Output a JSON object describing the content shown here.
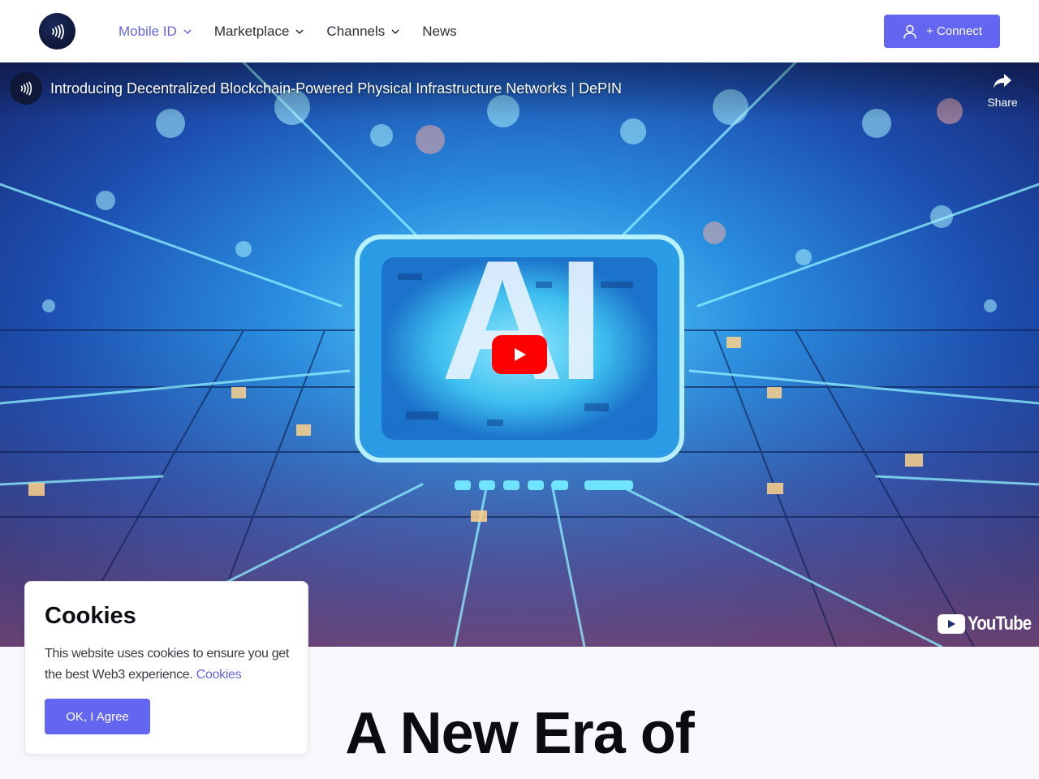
{
  "header": {
    "logo_icon": "nfc-wave-icon",
    "nav": [
      {
        "label": "Mobile ID",
        "has_dropdown": true,
        "active": true
      },
      {
        "label": "Marketplace",
        "has_dropdown": true,
        "active": false
      },
      {
        "label": "Channels",
        "has_dropdown": true,
        "active": false
      },
      {
        "label": "News",
        "has_dropdown": false,
        "active": false
      }
    ],
    "connect_label": "+ Connect",
    "connect_icon": "user-icon"
  },
  "video": {
    "title": "Introducing Decentralized Blockchain-Powered Physical Infrastructure Networks | DePIN",
    "share_label": "Share",
    "share_icon": "share-arrow-icon",
    "play_icon": "play-icon",
    "platform_label": "YouTube",
    "thumbnail_text": "AI"
  },
  "hero": {
    "title_line1": "A New Era of"
  },
  "cookies": {
    "title": "Cookies",
    "text": "This website uses cookies to ensure you get the best Web3 experience.",
    "link_label": "Cookies",
    "accept_label": "OK, I Agree"
  },
  "colors": {
    "accent": "#6366f1",
    "active_nav": "#6366e0",
    "youtube_red": "#ff0000",
    "logo_bg": "#0d1533"
  }
}
